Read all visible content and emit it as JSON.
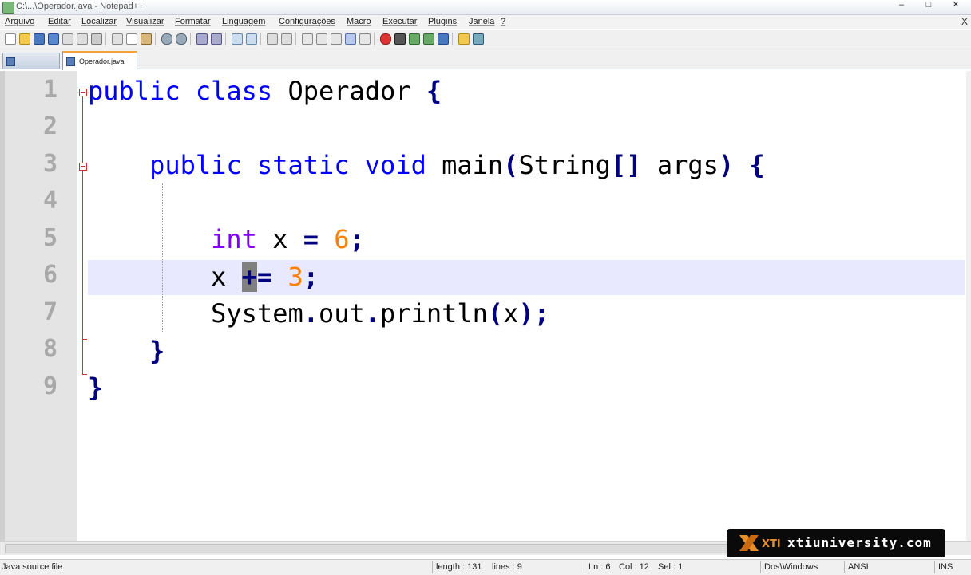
{
  "window": {
    "title": "C:\\...\\Operador.java - Notepad++",
    "minimize": "–",
    "maximize": "□",
    "close": "✕"
  },
  "menu": {
    "items": [
      "Arquivo",
      "Editar",
      "Localizar",
      "Visualizar",
      "Formatar",
      "Linguagem",
      "Configurações",
      "Macro",
      "Executar",
      "Plugins",
      "Janela",
      "?"
    ],
    "close": "X"
  },
  "toolbar": {
    "icons": [
      "new-file-icon",
      "open-file-icon",
      "save-icon",
      "save-all-icon",
      "close-icon",
      "close-all-icon",
      "print-icon",
      "cut-icon",
      "copy-icon",
      "paste-icon",
      "undo-icon",
      "redo-icon",
      "find-icon",
      "replace-icon",
      "zoom-in-icon",
      "zoom-out-icon",
      "sync-v-icon",
      "sync-h-icon",
      "word-wrap-icon",
      "show-all-chars-icon",
      "indent-guide-icon",
      "doc-map-icon",
      "function-list-icon",
      "record-macro-icon",
      "stop-macro-icon",
      "play-macro-icon",
      "run-macro-icon",
      "save-macro-icon",
      "open-folder-icon",
      "launch-icon"
    ]
  },
  "tabs": [
    {
      "label": "",
      "active": false
    },
    {
      "label": "Operador.java",
      "active": true
    }
  ],
  "editor": {
    "line_numbers": [
      "1",
      "2",
      "3",
      "4",
      "5",
      "6",
      "7",
      "8",
      "9"
    ],
    "current_line": 6,
    "lines": [
      "public class Operador {",
      "",
      "    public static void main(String[] args) {",
      "",
      "        int x = 6;",
      "        x += 3;",
      "        System.out.println(x);",
      "    }",
      "}"
    ]
  },
  "status": {
    "file_type": "Java source file",
    "length": "length : 131",
    "lines": "lines : 9",
    "ln": "Ln : 6",
    "col": "Col : 12",
    "sel": "Sel : 1",
    "eol": "Dos\\Windows",
    "encoding": "ANSI",
    "mode": "INS"
  },
  "watermark": {
    "logo": "XTI",
    "text": "xtiuniversity.com"
  }
}
